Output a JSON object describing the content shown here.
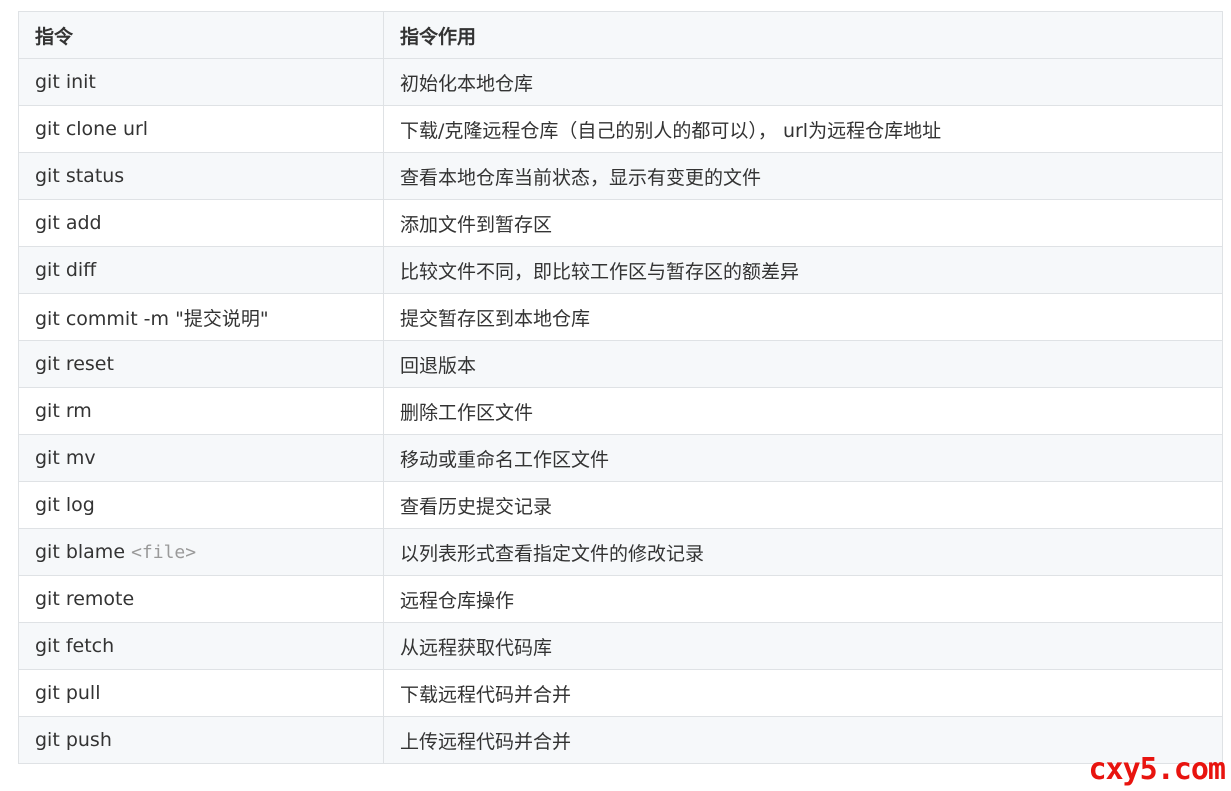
{
  "table": {
    "headers": [
      "指令",
      "指令作用"
    ],
    "rows": [
      {
        "command": "git init",
        "arg": "",
        "description": "初始化本地仓库"
      },
      {
        "command": "git clone url",
        "arg": "",
        "description": "下载/克隆远程仓库（自己的别人的都可以）， url为远程仓库地址"
      },
      {
        "command": "git status",
        "arg": "",
        "description": "查看本地仓库当前状态，显示有变更的文件"
      },
      {
        "command": "git add",
        "arg": "",
        "description": "添加文件到暂存区"
      },
      {
        "command": "git diff",
        "arg": "",
        "description": "比较文件不同，即比较工作区与暂存区的额差异"
      },
      {
        "command": "git commit -m \"提交说明\"",
        "arg": "",
        "description": "提交暂存区到本地仓库"
      },
      {
        "command": "git reset",
        "arg": "",
        "description": "回退版本"
      },
      {
        "command": "git rm",
        "arg": "",
        "description": "删除工作区文件"
      },
      {
        "command": "git mv",
        "arg": "",
        "description": "移动或重命名工作区文件"
      },
      {
        "command": "git log",
        "arg": "",
        "description": "查看历史提交记录"
      },
      {
        "command": "git blame",
        "arg": "<file>",
        "description": "以列表形式查看指定文件的修改记录"
      },
      {
        "command": "git remote",
        "arg": "",
        "description": "远程仓库操作"
      },
      {
        "command": "git fetch",
        "arg": "",
        "description": "从远程获取代码库"
      },
      {
        "command": "git pull",
        "arg": "",
        "description": "下载远程代码并合并"
      },
      {
        "command": "git push",
        "arg": "",
        "description": "上传远程代码并合并"
      }
    ]
  },
  "watermark": "cxy5.com",
  "colors": {
    "border": "#dfe2e5",
    "stripe": "#f6f8fa",
    "text": "#333333",
    "inline_code": "#9a9a9a",
    "watermark": "#e8140f"
  }
}
